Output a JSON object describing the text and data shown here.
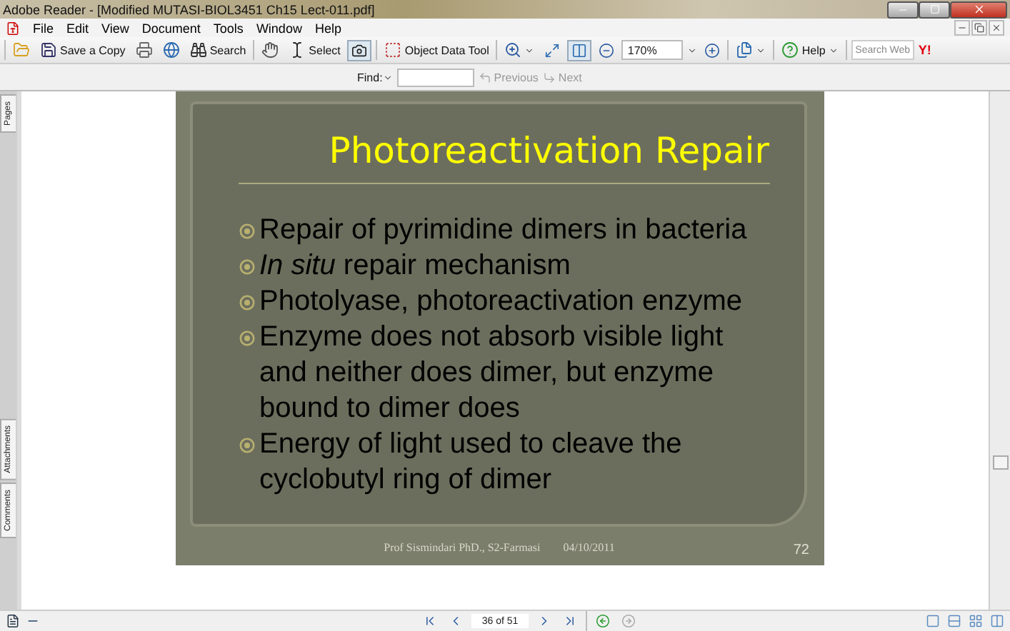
{
  "window": {
    "title": "Adobe Reader - [Modified MUTASI-BIOL3451 Ch15 Lect-011.pdf]"
  },
  "menu": [
    "File",
    "Edit",
    "View",
    "Document",
    "Tools",
    "Window",
    "Help"
  ],
  "toolbar": {
    "save_label": "Save a Copy",
    "search_label": "Search",
    "select_label": "Select",
    "object_tool_label": "Object Data Tool",
    "zoom_value": "170%",
    "help_label": "Help",
    "web_search_placeholder": "Search Web",
    "search_logo": "Y!"
  },
  "find_bar": {
    "label": "Find:",
    "previous": "Previous",
    "next": "Next"
  },
  "side_tabs_top": [
    "Pages"
  ],
  "side_tabs_bottom": [
    "Attachments",
    "Comments"
  ],
  "slide": {
    "title": "Photoreactivation Repair",
    "bullets": [
      "Repair of pyrimidine dimers in bacteria",
      "*In situ* repair mechanism",
      "Photolyase, photoreactivation enzyme",
      "Enzyme does not absorb visible light and neither does dimer, but enzyme bound to dimer does",
      "Energy of light used to cleave the cyclobutyl ring of dimer"
    ],
    "footer": "Prof Sismindari PhD., S2-Farmasi",
    "date": "04/10/2011",
    "number": "72"
  },
  "status_bar": {
    "page": "36 of 51"
  }
}
